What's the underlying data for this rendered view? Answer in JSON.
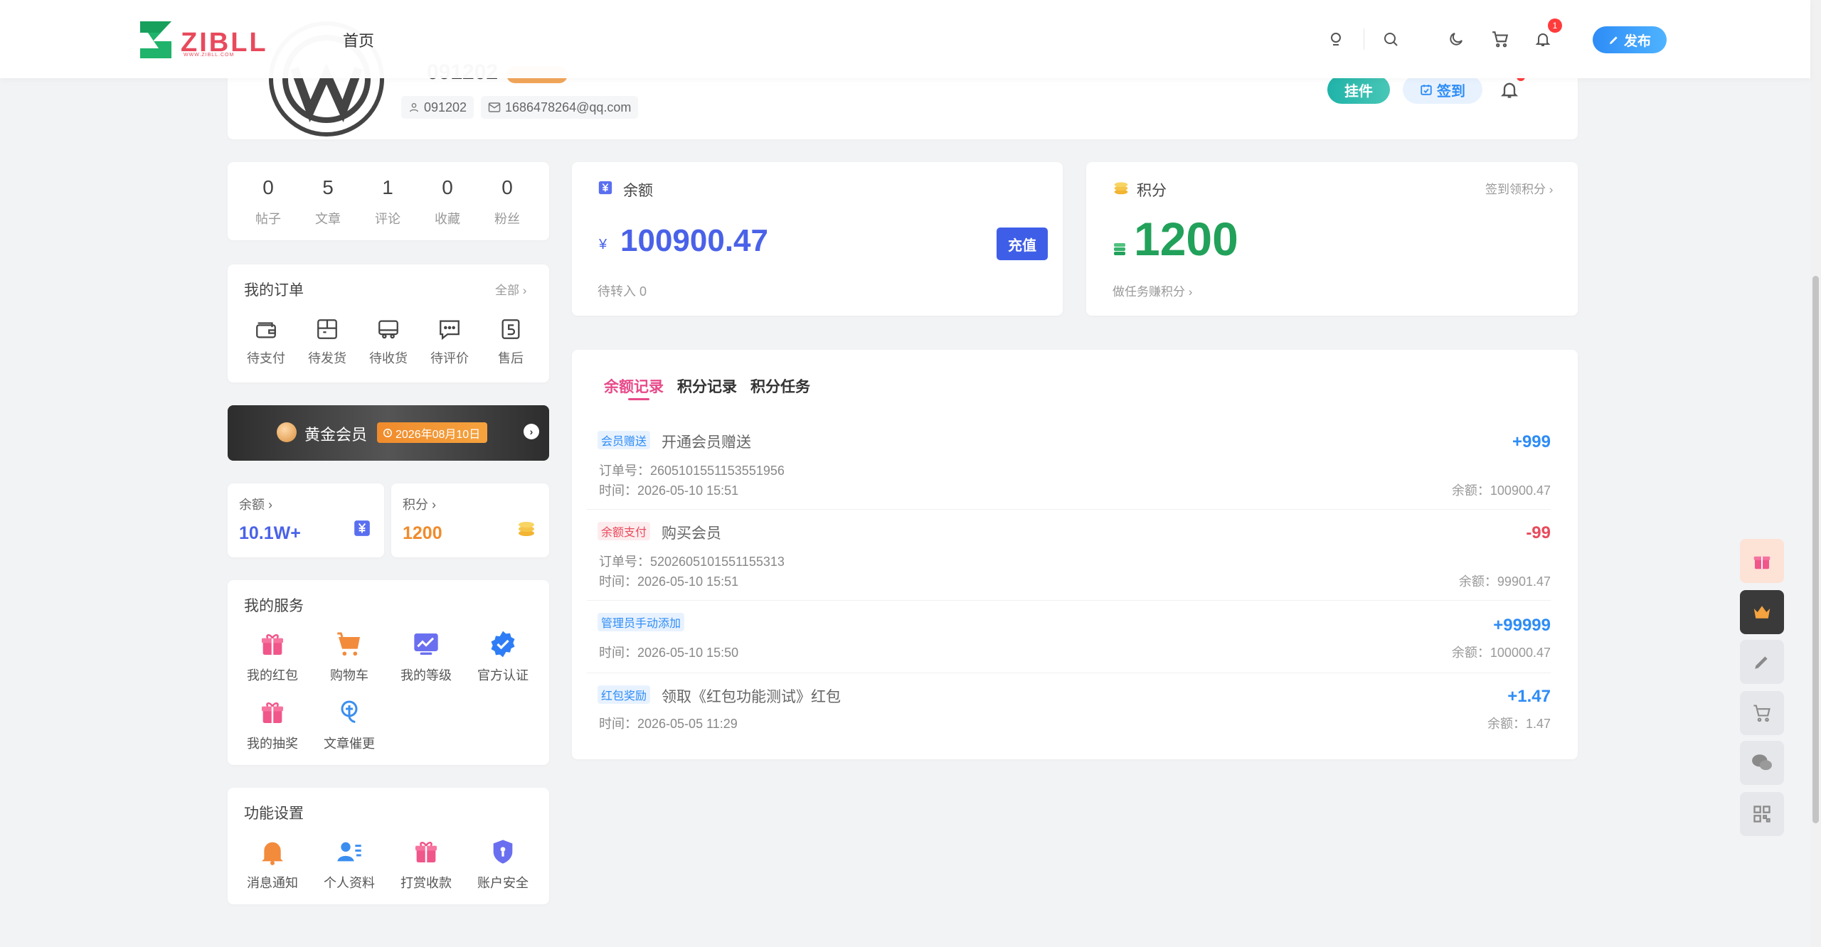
{
  "header": {
    "logo_text": "ZIBLL",
    "logo_sub": "WWW.ZIBLL.COM",
    "nav_home": "首页",
    "notif_count": "1",
    "publish": "发布"
  },
  "profile": {
    "name": "091202",
    "user_id": "091202",
    "email": "1686478264@qq.com",
    "pendant": "挂件",
    "signin": "签到"
  },
  "stats": [
    {
      "value": "0",
      "label": "帖子"
    },
    {
      "value": "5",
      "label": "文章"
    },
    {
      "value": "1",
      "label": "评论"
    },
    {
      "value": "0",
      "label": "收藏"
    },
    {
      "value": "0",
      "label": "粉丝"
    }
  ],
  "orders": {
    "title": "我的订单",
    "all": "全部",
    "items": [
      {
        "label": "待支付",
        "icon": "wallet-icon"
      },
      {
        "label": "待发货",
        "icon": "box-icon"
      },
      {
        "label": "待收货",
        "icon": "truck-icon"
      },
      {
        "label": "待评价",
        "icon": "comment-icon"
      },
      {
        "label": "售后",
        "icon": "aftersale-icon"
      }
    ]
  },
  "vip": {
    "name": "黄金会员",
    "expire": "2026年08月10日"
  },
  "mini": {
    "balance_label": "余额",
    "balance_value": "10.1W+",
    "points_label": "积分",
    "points_value": "1200"
  },
  "services": {
    "title": "我的服务",
    "items": [
      {
        "label": "我的红包",
        "icon": "gift-icon"
      },
      {
        "label": "购物车",
        "icon": "cart-icon"
      },
      {
        "label": "我的等级",
        "icon": "level-icon"
      },
      {
        "label": "官方认证",
        "icon": "verified-icon"
      },
      {
        "label": "我的抽奖",
        "icon": "lottery-icon"
      },
      {
        "label": "文章催更",
        "icon": "hand-icon"
      }
    ]
  },
  "settings": {
    "title": "功能设置",
    "items": [
      {
        "label": "消息通知",
        "icon": "bell-icon"
      },
      {
        "label": "个人资料",
        "icon": "profile-icon"
      },
      {
        "label": "打赏收款",
        "icon": "reward-icon"
      },
      {
        "label": "账户安全",
        "icon": "shield-icon"
      }
    ]
  },
  "balance": {
    "title": "余额",
    "currency": "¥",
    "value": "100900.47",
    "recharge": "充值",
    "pending": "待转入 0"
  },
  "points": {
    "title": "积分",
    "signin_link": "签到领积分",
    "value": "1200",
    "task_link": "做任务赚积分"
  },
  "records": {
    "tabs": [
      "余额记录",
      "积分记录",
      "积分任务"
    ],
    "items": [
      {
        "tag": "会员赠送",
        "tag_color": "#2e8cf6",
        "tag_bg": "#e8f2ff",
        "title": "开通会员赠送",
        "order": "订单号：2605101551153551956",
        "time": "时间：2026-05-10 15:51",
        "amount": "+999",
        "amount_color": "#2e8cf6",
        "balance": "余额：100900.47"
      },
      {
        "tag": "余额支付",
        "tag_color": "#e84a5c",
        "tag_bg": "#fdecee",
        "title": "购买会员",
        "order": "订单号：5202605101551155313",
        "time": "时间：2026-05-10 15:51",
        "amount": "-99",
        "amount_color": "#e84a5c",
        "balance": "余额：99901.47"
      },
      {
        "tag": "管理员手动添加",
        "tag_color": "#2e8cf6",
        "tag_bg": "#e8f2ff",
        "title": "",
        "order": "",
        "time": "时间：2026-05-10 15:50",
        "amount": "+99999",
        "amount_color": "#2e8cf6",
        "balance": "余额：100000.47"
      },
      {
        "tag": "红包奖励",
        "tag_color": "#2e8cf6",
        "tag_bg": "#e8f2ff",
        "title": "领取《红包功能测试》红包",
        "order": "",
        "time": "时间：2026-05-05 11:29",
        "amount": "+1.47",
        "amount_color": "#2e8cf6",
        "balance": "余额：1.47"
      }
    ]
  },
  "floatbar": [
    "gift-icon",
    "crown-icon",
    "pencil-icon",
    "cart-icon",
    "wechat-icon",
    "qrcode-icon"
  ]
}
